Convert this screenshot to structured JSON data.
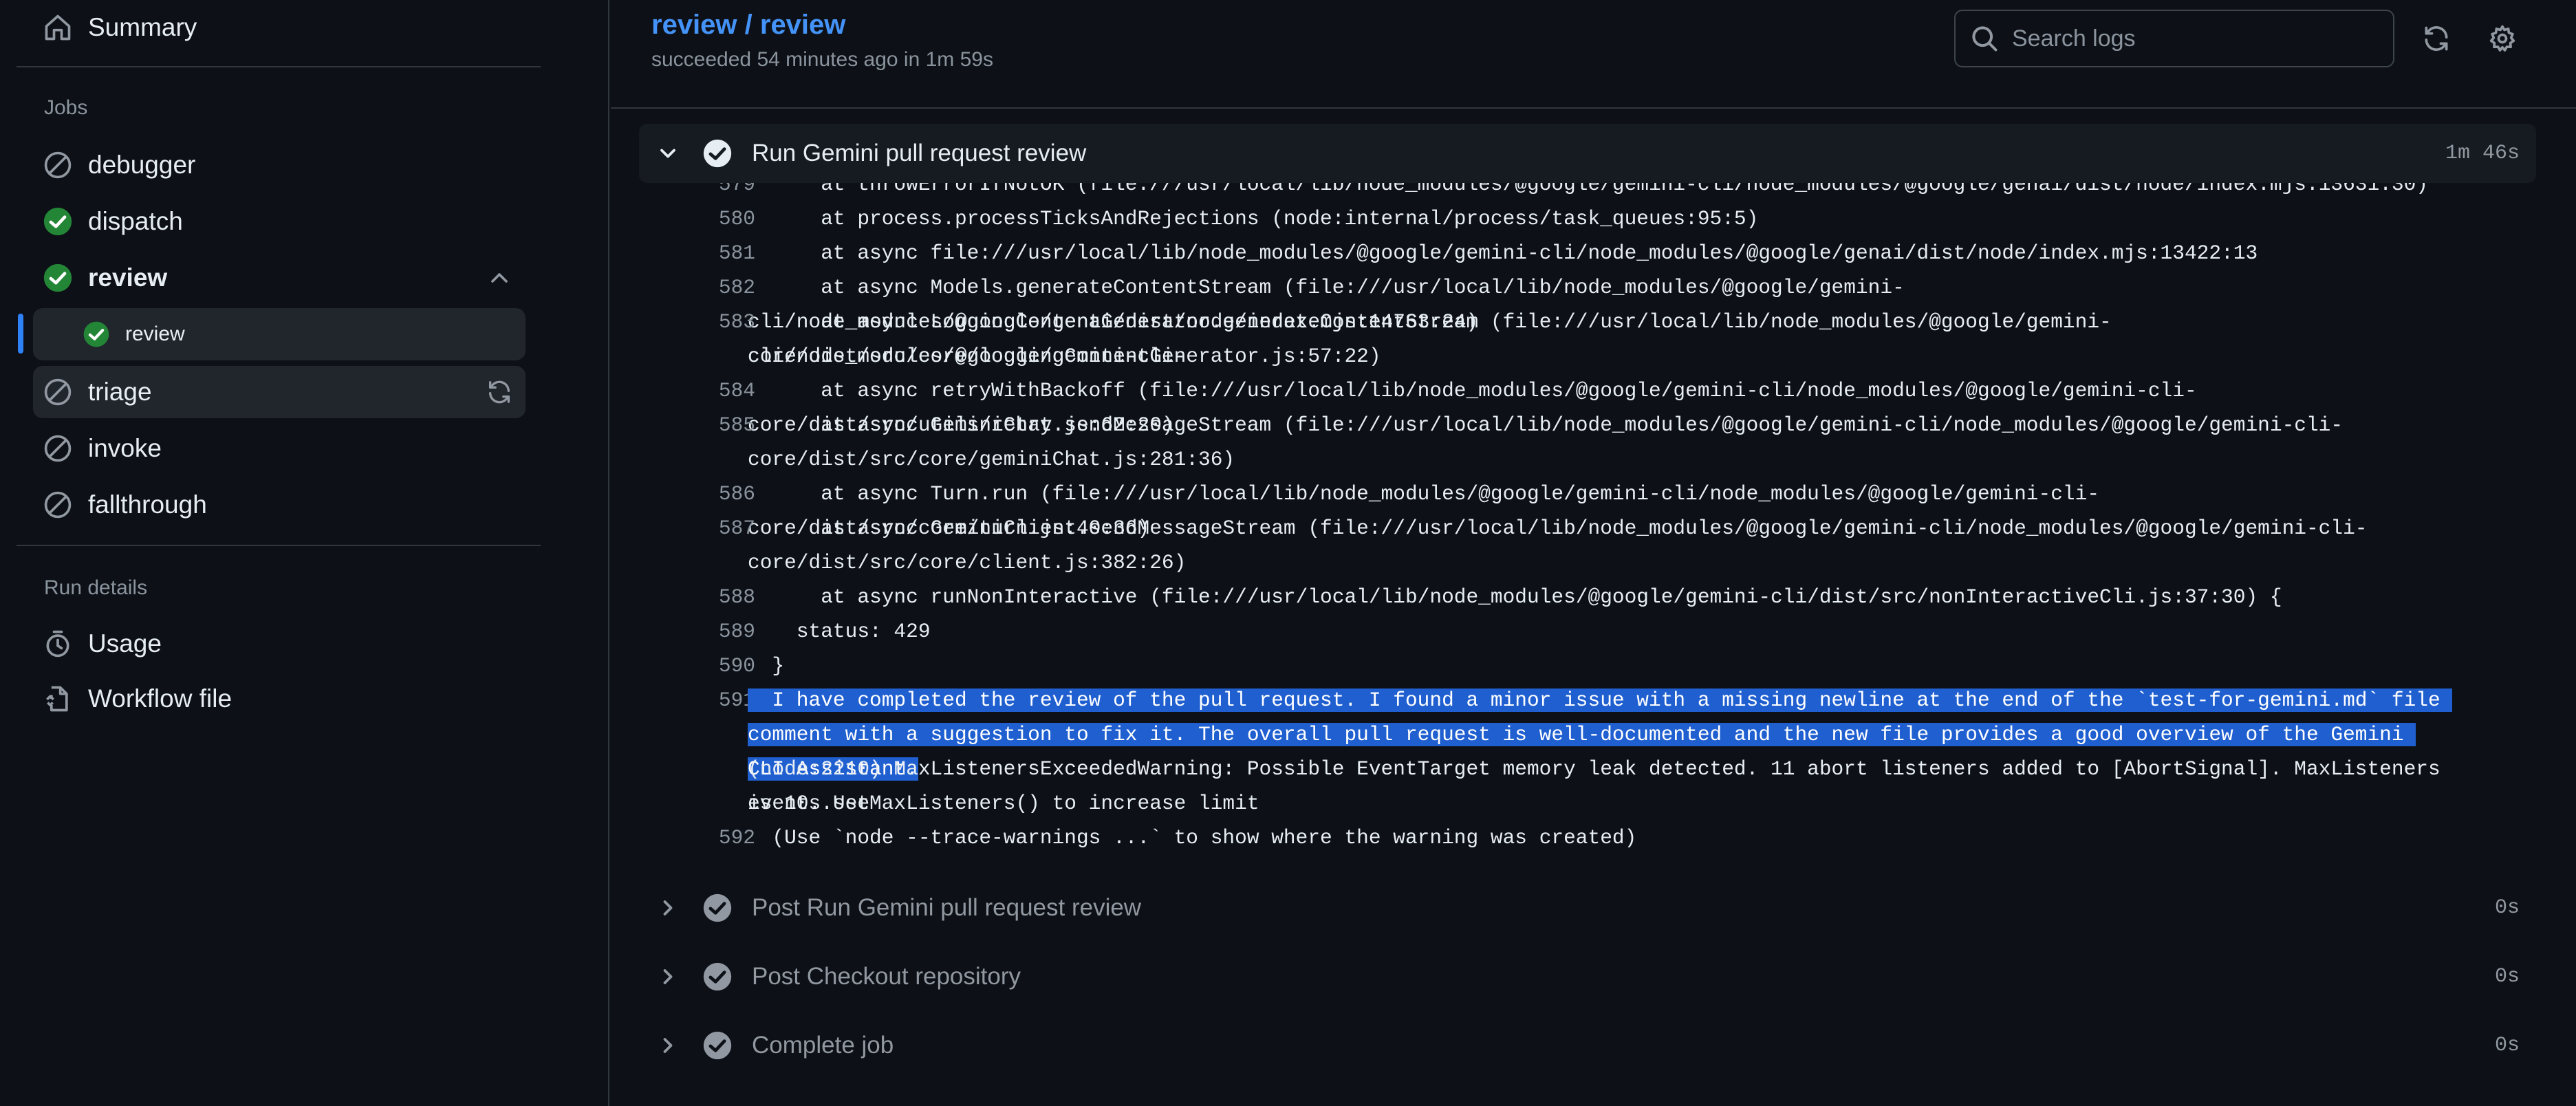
{
  "sidebar": {
    "summary": "Summary",
    "jobs_heading": "Jobs",
    "jobs": [
      {
        "label": "debugger",
        "status": "skipped"
      },
      {
        "label": "dispatch",
        "status": "success"
      },
      {
        "label": "review",
        "status": "success"
      },
      {
        "label": "review",
        "status": "success"
      },
      {
        "label": "triage",
        "status": "skipped"
      },
      {
        "label": "invoke",
        "status": "skipped"
      },
      {
        "label": "fallthrough",
        "status": "skipped"
      }
    ],
    "run_details_heading": "Run details",
    "usage": "Usage",
    "workflow_file": "Workflow file"
  },
  "header": {
    "title": "review / review",
    "status": "succeeded 54 minutes ago in 1m 59s",
    "search_placeholder": "Search logs"
  },
  "steps": {
    "current": {
      "name": "Run Gemini pull request review",
      "duration": "1m 46s"
    },
    "after": [
      {
        "name": "Post Run Gemini pull request review",
        "duration": "0s"
      },
      {
        "name": "Post Checkout repository",
        "duration": "0s"
      },
      {
        "name": "Complete job",
        "duration": "0s"
      }
    ]
  },
  "log": [
    {
      "num": "579",
      "text": "      at throwErrorIfNotOK (file:///usr/local/lib/node_modules/@google/gemini-cli/node_modules/@google/genai/dist/node/index.mjs:13631:30)"
    },
    {
      "num": "580",
      "text": "      at process.processTicksAndRejections (node:internal/process/task_queues:95:5)"
    },
    {
      "num": "581",
      "text": "      at async file:///usr/local/lib/node_modules/@google/gemini-cli/node_modules/@google/genai/dist/node/index.mjs:13422:13"
    },
    {
      "num": "582",
      "text": "      at async Models.generateContentStream (file:///usr/local/lib/node_modules/@google/gemini-cli/node_modules/@google/genai/dist/node/index.mjs:14763:24)"
    },
    {
      "num": "583",
      "text": "      at async LoggingContentGenerator.generateContentStream (file:///usr/local/lib/node_modules/@google/gemini-cli/node_modules/@google/gemini-cli-"
    },
    {
      "num": "",
      "text": "core/dist/src/core/loggingContentGenerator.js:57:22)"
    },
    {
      "num": "584",
      "text": "      at async retryWithBackoff (file:///usr/local/lib/node_modules/@google/gemini-cli/node_modules/@google/gemini-cli-core/dist/src/utils/retry.js:62:20)"
    },
    {
      "num": "585",
      "text": "      at async GeminiChat.sendMessageStream (file:///usr/local/lib/node_modules/@google/gemini-cli/node_modules/@google/gemini-cli-"
    },
    {
      "num": "",
      "text": "core/dist/src/core/geminiChat.js:281:36)"
    },
    {
      "num": "586",
      "text": "      at async Turn.run (file:///usr/local/lib/node_modules/@google/gemini-cli/node_modules/@google/gemini-cli-core/dist/src/core/turn.js:40:36)"
    },
    {
      "num": "587",
      "text": "      at async GeminiClient.sendMessageStream (file:///usr/local/lib/node_modules/@google/gemini-cli/node_modules/@google/gemini-cli-"
    },
    {
      "num": "",
      "text": "core/dist/src/core/client.js:382:26)"
    },
    {
      "num": "588",
      "text": "      at async runNonInteractive (file:///usr/local/lib/node_modules/@google/gemini-cli/dist/src/nonInteractiveCli.js:37:30) {"
    },
    {
      "num": "589",
      "text": "    status: 429"
    },
    {
      "num": "590",
      "text": "  }"
    },
    {
      "num": "591",
      "text": "  I have completed the review of the pull request. I found a minor issue with a missing newline at the end of the `test-for-gemini.md` file and submitted a",
      "selected": true
    },
    {
      "num": "",
      "text": "comment with a suggestion to fix it. The overall pull request is well-documented and the new file provides a good overview of the Gemini CLI Assistant.",
      "selected": true
    },
    {
      "num": "",
      "text": "(node:2210) MaxListenersExceededWarning: Possible EventTarget memory leak detected. 11 abort listeners added to [AbortSignal]. MaxListeners is 10. Use"
    },
    {
      "num": "",
      "text": "events.setMaxListeners() to increase limit"
    },
    {
      "num": "592",
      "text": "  (Use `node --trace-warnings ...` to show where the warning was created)"
    }
  ]
}
